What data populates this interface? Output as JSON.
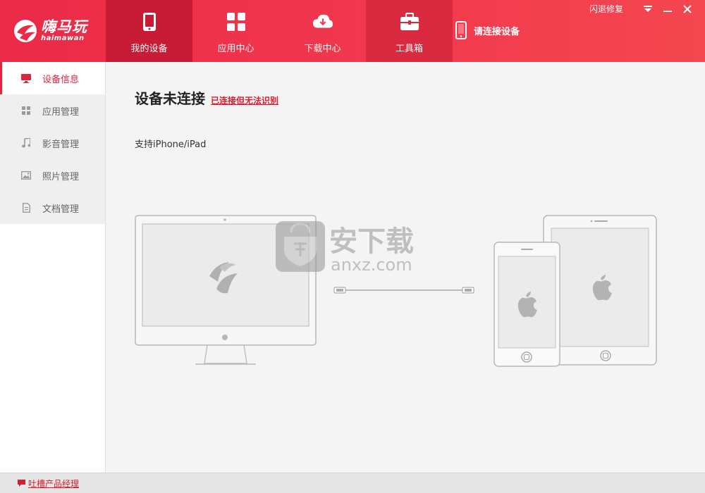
{
  "app": {
    "logo_cn": "嗨马玩",
    "logo_en": "haimawan"
  },
  "nav": {
    "tabs": [
      {
        "label": "我的设备",
        "icon": "phone-icon"
      },
      {
        "label": "应用中心",
        "icon": "grid-icon"
      },
      {
        "label": "下载中心",
        "icon": "cloud-download-icon"
      },
      {
        "label": "工具箱",
        "icon": "toolbox-icon"
      }
    ],
    "active_index": 0
  },
  "connection": {
    "status_text": "请连接设备",
    "icon": "phone-outline-icon"
  },
  "window": {
    "repair_label": "闪退修复",
    "controls": [
      "menu-icon",
      "minimize-icon",
      "close-icon"
    ]
  },
  "sidebar": {
    "items": [
      {
        "label": "设备信息",
        "icon": "monitor-icon"
      },
      {
        "label": "应用管理",
        "icon": "grid-small-icon"
      },
      {
        "label": "影音管理",
        "icon": "music-note-icon"
      },
      {
        "label": "照片管理",
        "icon": "picture-icon"
      },
      {
        "label": "文档管理",
        "icon": "document-icon"
      }
    ],
    "active_index": 0
  },
  "main": {
    "title": "设备未连接",
    "unrecognized_link": "已连接但无法识别",
    "support_text": "支持iPhone/iPad"
  },
  "watermark": {
    "text_cn": "安下载",
    "text_en": "anxz.com"
  },
  "footer": {
    "feedback_label": "吐槽产品经理"
  },
  "colors": {
    "accent": "#e0243c",
    "topbar": "#f23a4e",
    "topbar_active": "#c81b35"
  }
}
